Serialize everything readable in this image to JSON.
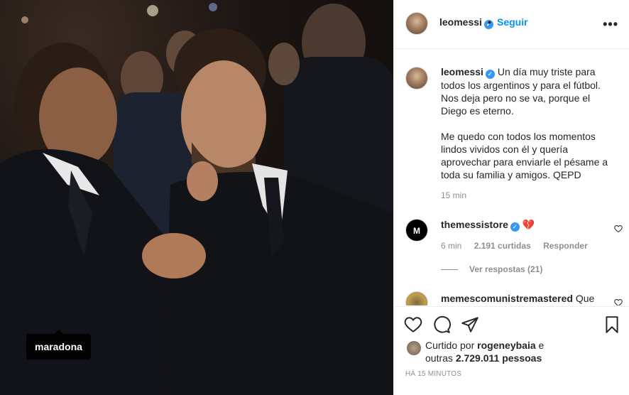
{
  "photo": {
    "tag_label": "maradona"
  },
  "post": {
    "username": "leomessi",
    "verified": true,
    "follow_label": "Seguir",
    "more_label": "•••"
  },
  "caption": {
    "username": "leomessi",
    "paragraph1": "Un día muy triste para todos los argentinos y para el fútbol. Nos deja pero no se va, porque el Diego es eterno.",
    "paragraph2": "Me quedo con todos los momentos lindos vividos con él y quería aprovechar para enviarle el pésame a toda su familia y amigos. QEPD",
    "time": "15 min"
  },
  "comments": [
    {
      "username": "themessistore",
      "text": "💔",
      "time": "6 min",
      "likes": "2.191 curtidas",
      "reply_label": "Responder",
      "view_replies": "Ver respostas (21)"
    },
    {
      "username": "memescomunistremastered",
      "text": "Que"
    }
  ],
  "actions": {
    "liked_by_prefix": "Curtido por",
    "liked_by_user": "rogeneybaia",
    "liked_by_and": "e",
    "others_prefix": "outras",
    "others_count": "2.729.011 pessoas",
    "timestamp": "HÁ 15 MINUTOS"
  },
  "icons": [
    "heart-icon",
    "comment-icon",
    "share-icon",
    "bookmark-icon",
    "more-icon",
    "verified-icon"
  ],
  "colors": {
    "accent": "#0095f6",
    "verified": "#3897f0",
    "muted": "#8e8e8e",
    "heart_red": "#ed4956"
  }
}
